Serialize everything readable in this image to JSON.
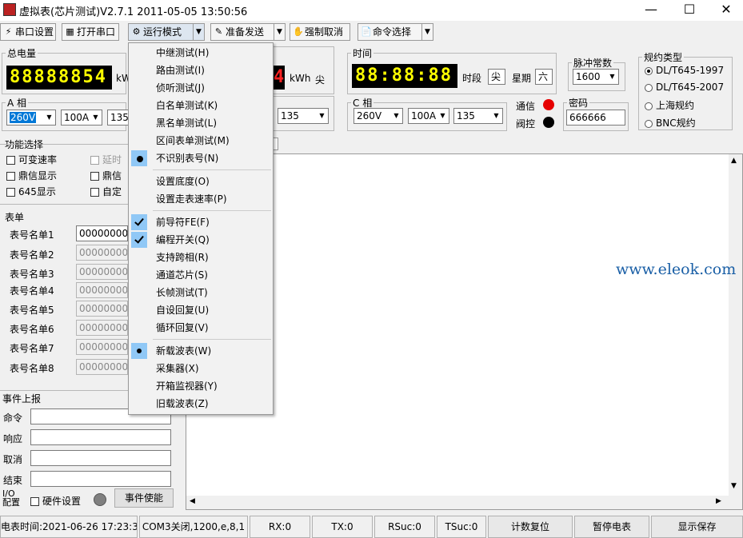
{
  "window": {
    "title": "虚拟表(芯片测试)V2.7.1 2011-05-05 13:50:56",
    "minimize": "—",
    "maximize": "☐",
    "close": "✕"
  },
  "toolbar": {
    "serial_settings": "串口设置",
    "open_serial": "打开串口",
    "run_mode": "运行模式",
    "prepare_send": "准备发送",
    "force_cancel": "强制取消",
    "command_select": "命令选择"
  },
  "energy": {
    "legend": "总电量",
    "display": "88888854",
    "unit": "kWh"
  },
  "energy2": {
    "display": "4",
    "unit": "kWh",
    "period": "尖"
  },
  "time": {
    "legend": "时间",
    "display": "88:88:88",
    "period_label": "时段",
    "period_value": "尖",
    "weekday_label": "星期",
    "weekday_value": "六"
  },
  "pulse": {
    "legend": "脉冲常数",
    "value": "1600"
  },
  "protocol": {
    "legend": "规约类型",
    "options": [
      "DL/T645-1997",
      "DL/T645-2007",
      "上海规约",
      "BNC规约"
    ],
    "selected": 0
  },
  "phase_a": {
    "legend": "A 相",
    "voltage": "260V",
    "current": "100A",
    "angle": "135"
  },
  "phase_b": {
    "angle": "135"
  },
  "phase_c": {
    "legend": "C 相",
    "voltage": "260V",
    "current": "100A",
    "angle": "135"
  },
  "comm": {
    "label": "通信",
    "color": "#e60000"
  },
  "valve": {
    "label": "阀控",
    "color": "#000000"
  },
  "password": {
    "legend": "密码",
    "value": "666666"
  },
  "functions": {
    "legend": "功能选择",
    "items": [
      "可变速率",
      "鼎信显示",
      "645显示",
      "延时",
      "鼎信",
      "自定"
    ]
  },
  "meter_table": {
    "legend": "表单",
    "rows": [
      {
        "label": "表号名单1",
        "value": "000000001"
      },
      {
        "label": "表号名单2",
        "value": "000000000"
      },
      {
        "label": "表号名单3",
        "value": "000000000"
      },
      {
        "label": "表号名单4",
        "value": "000000000"
      },
      {
        "label": "表号名单5",
        "value": "000000000"
      },
      {
        "label": "表号名单6",
        "value": "000000000"
      },
      {
        "label": "表号名单7",
        "value": "000000000"
      },
      {
        "label": "表号名单8",
        "value": "000000000"
      }
    ]
  },
  "events": {
    "legend": "事件上报",
    "command": "命令",
    "response": "响应",
    "cancel": "取消",
    "end": "结束",
    "io_config": "I/O\n配置",
    "hardware_settings": "硬件设置",
    "event_enable": "事件使能"
  },
  "menu": {
    "items": [
      {
        "label": "中继测试(H)",
        "mark": ""
      },
      {
        "label": "路由测试(I)",
        "mark": ""
      },
      {
        "label": "侦听测试(J)",
        "mark": ""
      },
      {
        "label": "白名单测试(K)",
        "mark": ""
      },
      {
        "label": "黑名单测试(L)",
        "mark": ""
      },
      {
        "label": "区间表单测试(M)",
        "mark": ""
      },
      {
        "label": "不识别表号(N)",
        "mark": "bullet"
      },
      {
        "label": "设置底度(O)",
        "mark": ""
      },
      {
        "label": "设置走表速率(P)",
        "mark": ""
      },
      {
        "label": "前导符FE(F)",
        "mark": "checked"
      },
      {
        "label": "编程开关(Q)",
        "mark": "checked"
      },
      {
        "label": "支持跨相(R)",
        "mark": ""
      },
      {
        "label": "通道芯片(S)",
        "mark": ""
      },
      {
        "label": "长帧测试(T)",
        "mark": ""
      },
      {
        "label": "自设回复(U)",
        "mark": ""
      },
      {
        "label": "循环回复(V)",
        "mark": ""
      },
      {
        "label": "新载波表(W)",
        "mark": "bullet"
      },
      {
        "label": "采集器(X)",
        "mark": ""
      },
      {
        "label": "开箱监视器(Y)",
        "mark": ""
      },
      {
        "label": "旧载波表(Z)",
        "mark": ""
      }
    ]
  },
  "watermark": "www.eleok.com",
  "statusbar": {
    "meter_time": "电表时间:2021-06-26 17:23:37",
    "com": "COM3关闭,1200,e,8,1",
    "rx": "RX:0",
    "tx": "TX:0",
    "rsuc": "RSuc:0",
    "tsuc": "TSuc:0",
    "reset_count": "计数复位",
    "pause_meter": "暂停电表",
    "show_save": "显示保存"
  }
}
